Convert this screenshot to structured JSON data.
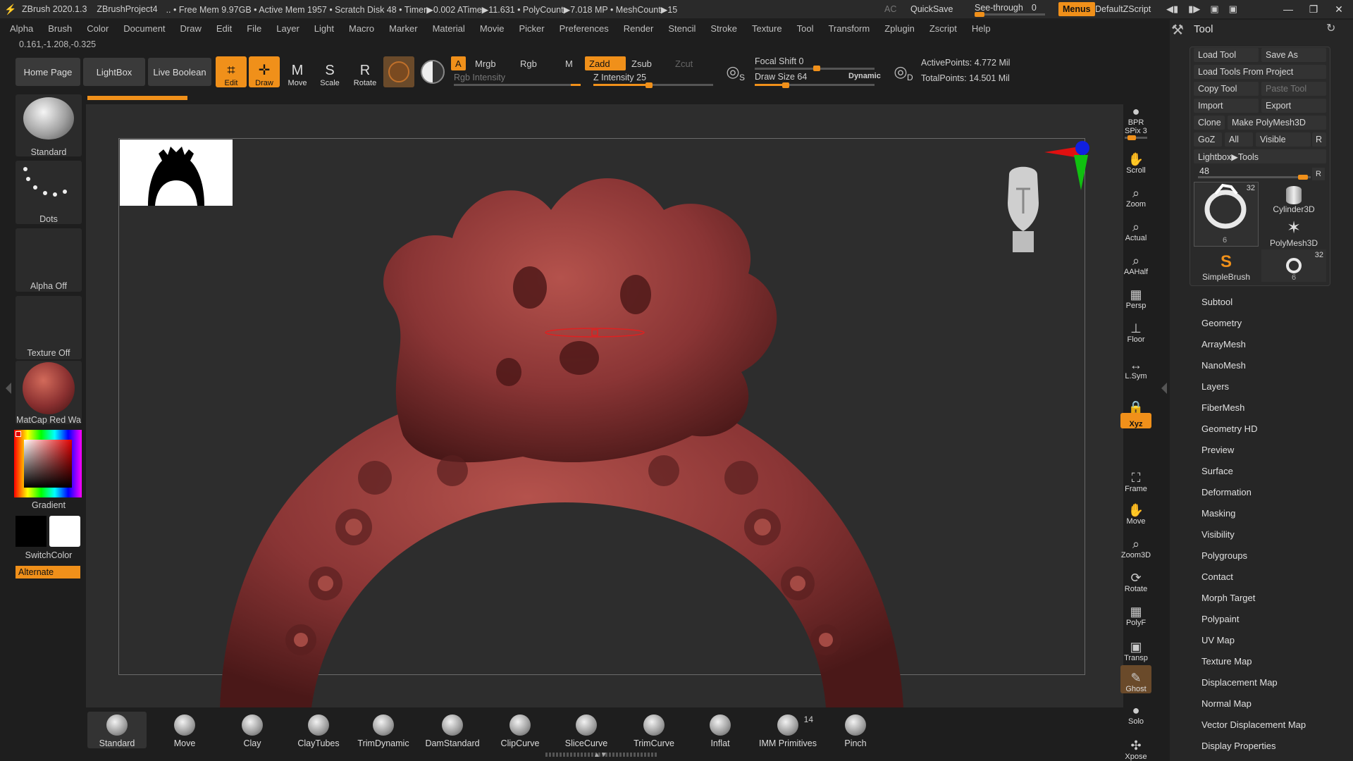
{
  "titlebar": {
    "app": "ZBrush 2020.1.3",
    "project": "ZBrushProject4",
    "stats": ".. • Free Mem 9.97GB • Active Mem 1957 • Scratch Disk 48 • Timer▶0.002 ATime▶11.631 • PolyCount▶7.018 MP • MeshCount▶15",
    "ac": "AC",
    "quicksave": "QuickSave",
    "see_through_label": "See-through",
    "see_through_value": "0",
    "menus": "Menus",
    "default_zscript": "DefaultZScript"
  },
  "menubar": [
    "Alpha",
    "Brush",
    "Color",
    "Document",
    "Draw",
    "Edit",
    "File",
    "Layer",
    "Light",
    "Macro",
    "Marker",
    "Material",
    "Movie",
    "Picker",
    "Preferences",
    "Render",
    "Stencil",
    "Stroke",
    "Texture",
    "Tool",
    "Transform",
    "Zplugin",
    "Zscript",
    "Help"
  ],
  "coords": "0.161,-1.208,-0.325",
  "toolbar": {
    "home_page": "Home Page",
    "lightbox": "LightBox",
    "live_boolean": "Live Boolean",
    "edit": "Edit",
    "draw": "Draw",
    "move": "Move",
    "scale": "Scale",
    "rotate": "Rotate",
    "a": "A",
    "mrgb": "Mrgb",
    "rgb": "Rgb",
    "m": "M",
    "zadd": "Zadd",
    "zsub": "Zsub",
    "zcut": "Zcut",
    "rgb_intensity": "Rgb Intensity",
    "z_intensity": "Z Intensity 25",
    "z_intensity_value": 25,
    "focal_shift": "Focal Shift 0",
    "draw_size": "Draw Size 64",
    "dynamic": "Dynamic",
    "active_points": "ActivePoints: 4.772 Mil",
    "total_points": "TotalPoints: 14.501 Mil",
    "s": "S",
    "d": "D"
  },
  "left_shelf": {
    "brush": "Standard",
    "stroke": "Dots",
    "alpha": "Alpha Off",
    "texture": "Texture Off",
    "material": "MatCap Red Wa",
    "gradient": "Gradient",
    "switchcolor": "SwitchColor",
    "alternate": "Alternate"
  },
  "right_column": [
    {
      "label": "BPR",
      "icon": "bpr-icon"
    },
    {
      "label": "SPix 3",
      "icon": "spix-slider"
    },
    {
      "label": "Scroll",
      "icon": "scroll-icon"
    },
    {
      "label": "Zoom",
      "icon": "zoom-icon"
    },
    {
      "label": "Actual",
      "icon": "actual-icon"
    },
    {
      "label": "AAHalf",
      "icon": "aahalf-icon"
    },
    {
      "label": "Persp",
      "icon": "persp-icon"
    },
    {
      "label": "Floor",
      "icon": "floor-icon"
    },
    {
      "label": "L.Sym",
      "icon": "lsym-icon"
    },
    {
      "label": "",
      "icon": "lock-icon"
    },
    {
      "label": "Xyz",
      "icon": "xyz-icon"
    },
    {
      "label": "Frame",
      "icon": "frame-icon"
    },
    {
      "label": "Move",
      "icon": "move-icon"
    },
    {
      "label": "Zoom3D",
      "icon": "zoom3d-icon"
    },
    {
      "label": "Rotate",
      "icon": "rotate-icon"
    },
    {
      "label": "PolyF",
      "icon": "polyf-icon"
    },
    {
      "label": "Transp",
      "icon": "transp-icon"
    },
    {
      "label": "Ghost",
      "icon": "ghost-icon"
    },
    {
      "label": "Solo",
      "icon": "solo-icon"
    },
    {
      "label": "Xpose",
      "icon": "xpose-icon"
    }
  ],
  "tool_panel": {
    "title": "Tool",
    "load_tool": "Load Tool",
    "save_as": "Save As",
    "load_tools_from_project": "Load Tools From Project",
    "copy_tool": "Copy Tool",
    "paste_tool": "Paste Tool",
    "import": "Import",
    "export": "Export",
    "clone": "Clone",
    "make_polymesh3d": "Make PolyMesh3D",
    "goz": "GoZ",
    "all": "All",
    "visible": "Visible",
    "r": "R",
    "lightbox_tools": "Lightbox▶Tools",
    "tool_count": "48",
    "thumbs": [
      {
        "label": "",
        "count": "32",
        "sub": "6"
      },
      {
        "label": "Cylinder3D",
        "count": "",
        "sub": ""
      },
      {
        "label": "PolyMesh3D",
        "count": "",
        "sub": ""
      },
      {
        "label": "SimpleBrush",
        "count": "",
        "sub": ""
      },
      {
        "label": "",
        "count": "32",
        "sub": "6"
      }
    ],
    "subpalettes": [
      "Subtool",
      "Geometry",
      "ArrayMesh",
      "NanoMesh",
      "Layers",
      "FiberMesh",
      "Geometry HD",
      "Preview",
      "Surface",
      "Deformation",
      "Masking",
      "Visibility",
      "Polygroups",
      "Contact",
      "Morph Target",
      "Polypaint",
      "UV Map",
      "Texture Map",
      "Displacement Map",
      "Normal Map",
      "Vector Displacement Map",
      "Display Properties"
    ]
  },
  "bottom_brushes": [
    {
      "name": "Standard"
    },
    {
      "name": "Move"
    },
    {
      "name": "Clay"
    },
    {
      "name": "ClayTubes"
    },
    {
      "name": "TrimDynamic"
    },
    {
      "name": "DamStandard"
    },
    {
      "name": "ClipCurve"
    },
    {
      "name": "SliceCurve"
    },
    {
      "name": "TrimCurve"
    },
    {
      "name": "Inflat"
    },
    {
      "name": "IMM Primitives",
      "badge": "14"
    },
    {
      "name": "Pinch"
    }
  ],
  "colors": {
    "accent": "#f0901a",
    "model": "#8a3535",
    "canvas": "#2d2d2d"
  }
}
